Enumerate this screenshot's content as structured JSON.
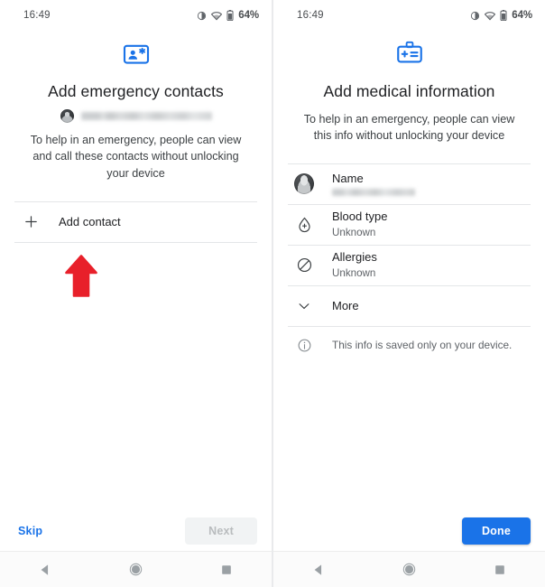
{
  "theme": {
    "accent_blue": "#1a73e8",
    "icon_blue": "#1a73e8",
    "arrow_red": "#e8202a",
    "text_primary": "#202124",
    "text_secondary": "#5f6368",
    "divider": "#e4e6e8",
    "background": "#ffffff"
  },
  "left_screen": {
    "status_bar": {
      "clock": "16:49",
      "battery_percent": "64%",
      "icons": [
        "vibrate-icon",
        "wifi-icon",
        "battery-icon"
      ]
    },
    "hero_icon": "emergency-contact-card-icon",
    "title": "Add emergency contacts",
    "account": {
      "avatar": "account-avatar",
      "email": "",
      "email_redacted": true
    },
    "subtitle": "To help in an emergency, people can view and call these contacts without unlocking your device",
    "add_contact": {
      "icon": "plus-icon",
      "label": "Add contact"
    },
    "annotation": {
      "shape": "up-arrow",
      "color": "#e8202a"
    },
    "bottom_bar": {
      "skip_label": "Skip",
      "next_label": "Next",
      "next_enabled": false
    },
    "nav_bar": {
      "back": "back-triangle-icon",
      "home": "home-circle-icon",
      "recents": "recents-square-icon"
    }
  },
  "right_screen": {
    "status_bar": {
      "clock": "16:49",
      "battery_percent": "64%",
      "icons": [
        "vibrate-icon",
        "wifi-icon",
        "battery-icon"
      ]
    },
    "hero_icon": "medical-id-badge-icon",
    "title": "Add medical information",
    "subtitle": "To help in an emergency, people can view this info without unlocking your device",
    "items": [
      {
        "icon": "account-avatar",
        "label": "Name",
        "value": "",
        "value_redacted": true
      },
      {
        "icon": "blood-drop-icon",
        "label": "Blood type",
        "value": "Unknown",
        "value_redacted": false
      },
      {
        "icon": "allergies-block-icon",
        "label": "Allergies",
        "value": "Unknown",
        "value_redacted": false
      },
      {
        "icon": "chevron-down-icon",
        "label": "More",
        "value": "",
        "value_redacted": false
      }
    ],
    "info_note": {
      "icon": "info-icon",
      "text": "This info is saved only on your device."
    },
    "bottom_bar": {
      "done_label": "Done"
    },
    "nav_bar": {
      "back": "back-triangle-icon",
      "home": "home-circle-icon",
      "recents": "recents-square-icon"
    }
  }
}
